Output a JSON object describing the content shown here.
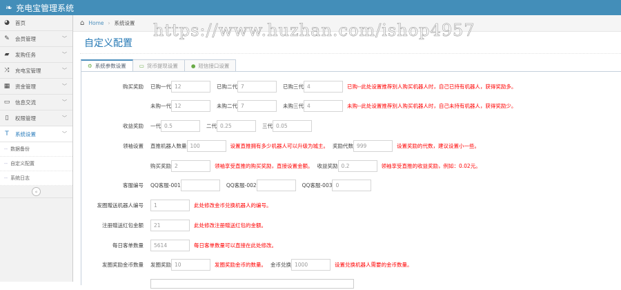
{
  "app": {
    "title": "充电宝管理系统"
  },
  "sidebar": {
    "items": [
      {
        "label": "首页",
        "icon": "dashboard-icon"
      },
      {
        "label": "会员管理",
        "icon": "edit-icon"
      },
      {
        "label": "发购任务",
        "icon": "book-icon"
      },
      {
        "label": "充电宝管理",
        "icon": "shuffle-icon"
      },
      {
        "label": "资金管理",
        "icon": "calendar-icon"
      },
      {
        "label": "信息交流",
        "icon": "card-icon"
      },
      {
        "label": "权限管理",
        "icon": "file-icon"
      },
      {
        "label": "系统设置",
        "icon": "text-icon"
      }
    ],
    "subitems": [
      "数据备份",
      "自定义配置",
      "系统日志"
    ]
  },
  "breadcrumb": {
    "home": "Home",
    "current": "系统设置"
  },
  "watermark": "https://www.huzhan.com/ishop4957",
  "page_title": "自定义配置",
  "tabs": [
    "系统参数设置",
    "货币提现设置",
    "短信接口设置"
  ],
  "form": {
    "buy_reward": {
      "label": "购买奖励",
      "bought": [
        {
          "label": "已购一代",
          "value": "12"
        },
        {
          "label": "已购二代",
          "value": "7"
        },
        {
          "label": "已购三代",
          "value": "4"
        }
      ],
      "bought_hint": "已购--此处设置推荐别人购买机器人时，自己已持有机器人，获得奖励多。",
      "unbought": [
        {
          "label": "未购一代",
          "value": "12"
        },
        {
          "label": "未购二代",
          "value": "7"
        },
        {
          "label": "未购三代",
          "value": "4"
        }
      ],
      "unbought_hint": "未购--此处设置推荐别人购买机器人时，自己未持有机器人，获得奖励少。"
    },
    "income_reward": {
      "label": "收益奖励",
      "fields": [
        {
          "label": "一代",
          "value": "0.5"
        },
        {
          "label": "二代",
          "value": "0.25"
        },
        {
          "label": "三代",
          "value": "0.05"
        }
      ]
    },
    "leader": {
      "label": "领袖设置",
      "robots_label": "直推机器人数量",
      "robots_value": "100",
      "robots_hint": "设置直推拥有多少机器人可以升级为城主。",
      "gen_label": "奖励代数",
      "gen_value": "999",
      "gen_hint": "设置奖励的代数，建议设置小一些。",
      "buy_label": "购买奖励",
      "buy_value": "2",
      "buy_hint": "领袖享受直推的购买奖励，直接设置金额。",
      "inc_label": "收益奖励",
      "inc_value": "0.2",
      "inc_hint": "领袖享受直推的收益奖励，例如：0.02元。"
    },
    "service": {
      "label": "客服编号",
      "fields": [
        {
          "label": "QQ客服-001",
          "value": ""
        },
        {
          "label": "QQ客服-002",
          "value": ""
        },
        {
          "label": "QQ客服-003",
          "value": "0"
        }
      ]
    },
    "gift_robot": {
      "label": "发圈赠送机器人编号",
      "value": "1",
      "hint": "此处修改金币兑换机器人的编号。"
    },
    "register_bonus": {
      "label": "注册赠送红包金额",
      "value": "21",
      "hint": "此处修改注册赠送红包的金额。"
    },
    "daily_orders": {
      "label": "每日客单数量",
      "value": "5614",
      "hint": "每日客单数量可以直接在此处修改。"
    },
    "coin_reward": {
      "label": "发圈奖励金币数量",
      "reward_label": "发圈奖励",
      "reward_value": "10",
      "reward_hint": "发圈奖励金币的数量。",
      "exchange_label": "金币兑换",
      "exchange_value": "1000",
      "exchange_hint": "设置兑换机器人需要的金币数量。"
    }
  }
}
